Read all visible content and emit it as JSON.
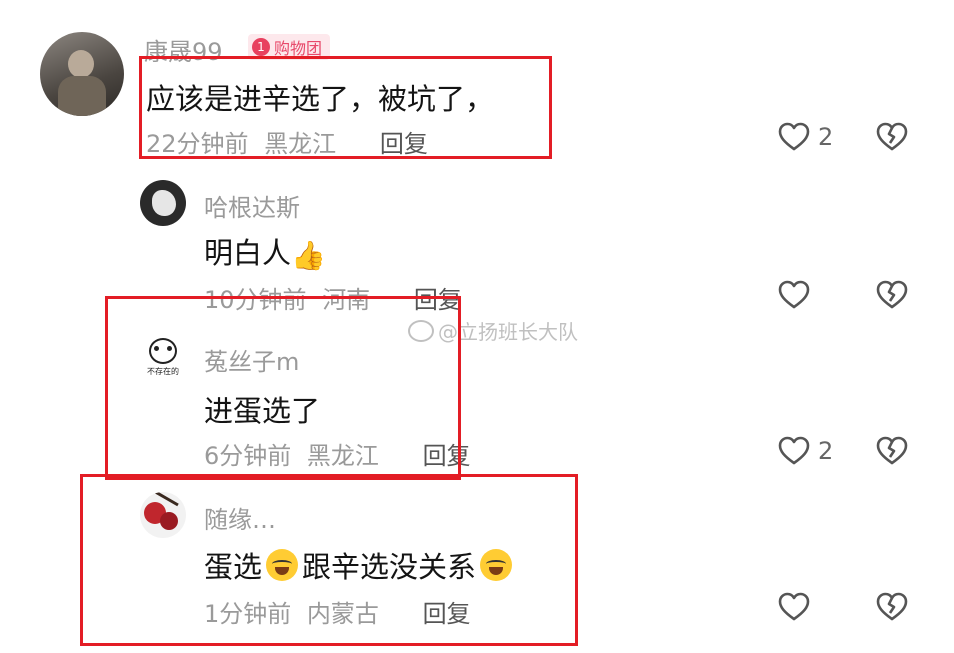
{
  "comments": [
    {
      "username": "康晟99",
      "badge": {
        "count": "1",
        "label": "购物团"
      },
      "text": "应该是进辛选了，被坑了，",
      "time": "22分钟前",
      "location": "黑龙江",
      "reply_label": "回复",
      "likes": "2"
    },
    {
      "username": "哈根达斯",
      "text": "明白人",
      "emoji_after": "👍",
      "time": "10分钟前",
      "location": "河南",
      "reply_label": "回复",
      "likes": ""
    },
    {
      "username": "菟丝子m",
      "avatar_caption": "不存在的",
      "text": "进蛋选了",
      "time": "6分钟前",
      "location": "黑龙江",
      "reply_label": "回复",
      "likes": "2"
    },
    {
      "username": "随缘…",
      "text_part1": "蛋选",
      "text_part2": "跟辛选没关系",
      "time": "1分钟前",
      "location": "内蒙古",
      "reply_label": "回复",
      "likes": ""
    }
  ],
  "watermark": "@立扬班长大队",
  "highlight_color": "#e31d25",
  "icons": [
    "heart-outline-icon",
    "broken-heart-icon",
    "thumbs-up-icon",
    "crying-laughing-icon",
    "weibo-icon"
  ]
}
